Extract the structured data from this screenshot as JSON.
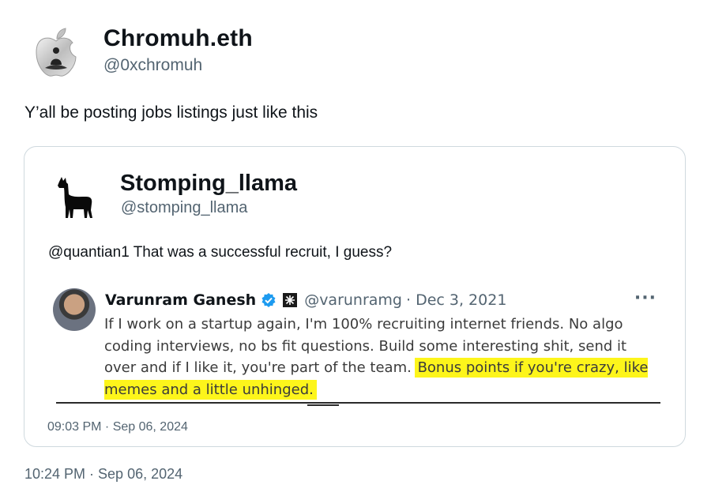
{
  "tweet": {
    "author_name": "Chromuh.eth",
    "author_handle": "@0xchromuh",
    "avatar_icon": "apple-logo-meditating-figure-icon",
    "text": "Y’all be posting jobs listings just like this",
    "timestamp": "10:24 PM · Sep 06, 2024"
  },
  "quoted_tweet": {
    "author_name": "Stomping_llama",
    "author_handle": "@stomping_llama",
    "avatar_icon": "llama-icon",
    "text": "@quantian1 That was a successful recruit, I guess?",
    "timestamp": "09:03 PM · Sep 06, 2024",
    "embedded": {
      "author_name": "Varunram Ganesh",
      "author_handle": "@varunramg",
      "date": "· Dec 3, 2021",
      "more_label": "···",
      "body_plain": "If I work on a startup again, I'm 100% recruiting internet friends. No algo coding interviews, no bs fit questions. Build some interesting shit, send it over and if I like it, you're part of the team.",
      "body_highlight": "Bonus points if you're crazy, like memes and a little unhinged.",
      "highlight_color": "#fdf51b"
    }
  },
  "colors": {
    "text_primary": "#0f1419",
    "text_secondary": "#536471",
    "border": "#cfd9de",
    "verified_blue": "#1d9bf0"
  }
}
